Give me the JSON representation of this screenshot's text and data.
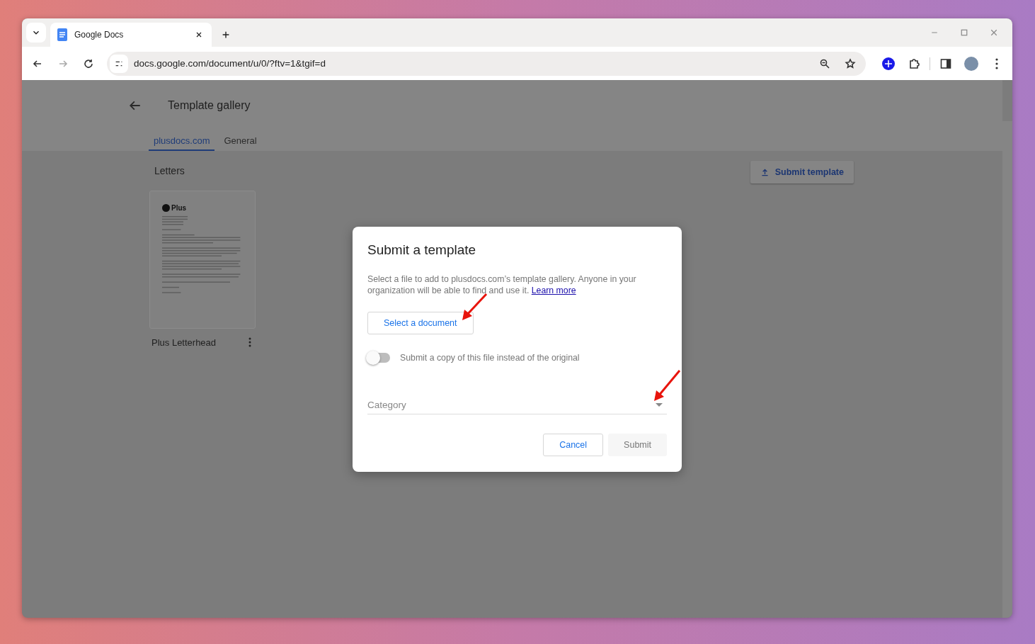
{
  "browser": {
    "tab": {
      "title": "Google Docs",
      "selected": true
    },
    "url": "docs.google.com/document/u/0/?ftv=1&tgif=d"
  },
  "page": {
    "title": "Template gallery",
    "tabs": [
      {
        "label": "plusdocs.com",
        "selected": true
      },
      {
        "label": "General",
        "selected": false
      }
    ],
    "section": "Letters",
    "submit_button": "Submit template",
    "templates": [
      {
        "name": "Plus Letterhead",
        "logo": "Plus"
      }
    ]
  },
  "dialog": {
    "title": "Submit a template",
    "description": "Select a file to add to plusdocs.com’s template gallery. Anyone in your organization will be able to find and use it.",
    "link": "Learn more",
    "select_button": "Select a document",
    "copy_toggle": {
      "label": "Submit a copy of this file instead of the original",
      "on": false
    },
    "category": {
      "placeholder": "Category"
    },
    "buttons": [
      {
        "label": "Cancel",
        "disabled": false
      },
      {
        "label": "Submit",
        "disabled": true
      }
    ]
  }
}
